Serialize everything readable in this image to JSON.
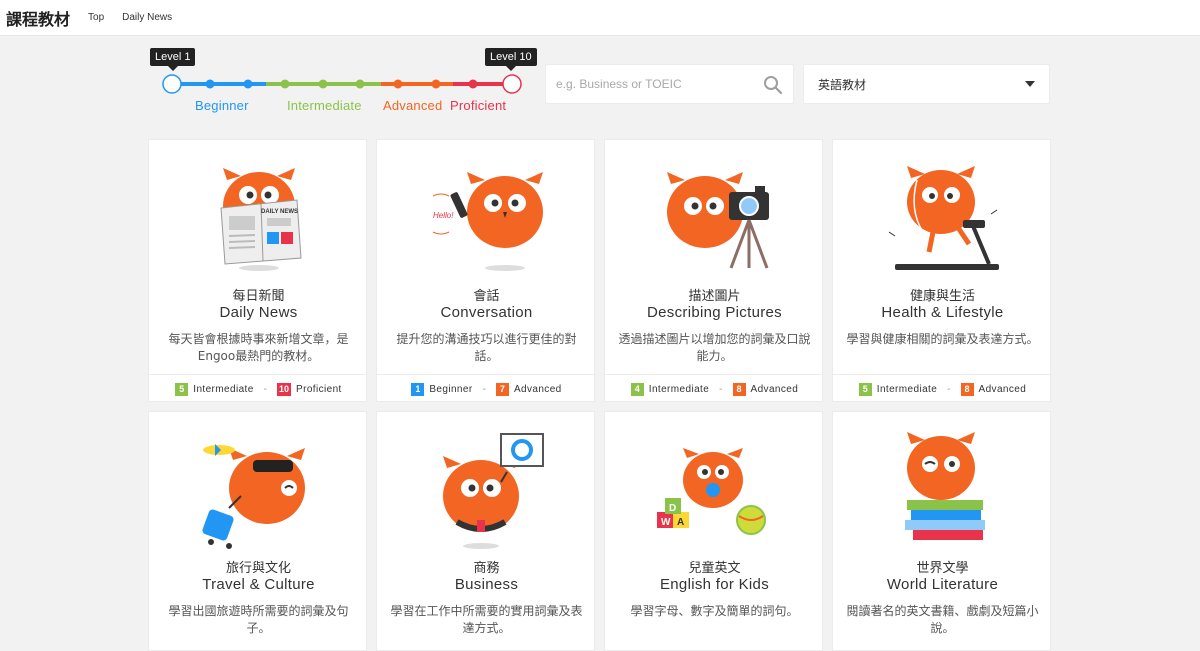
{
  "header": {
    "title": "課程教材",
    "nav": [
      "Top",
      "Daily News"
    ]
  },
  "slider": {
    "min_tip": "Level 1",
    "max_tip": "Level 10",
    "stages": [
      {
        "label": "Beginner",
        "color": "#2196f3"
      },
      {
        "label": "Intermediate",
        "color": "#8bc34a"
      },
      {
        "label": "Advanced",
        "color": "#f26522"
      },
      {
        "label": "Proficient",
        "color": "#e8334a"
      }
    ]
  },
  "search": {
    "placeholder": "e.g. Business or TOEIC",
    "icon": "search-icon"
  },
  "language_select": {
    "value": "英語教材"
  },
  "colors": {
    "beginner": "#2196f3",
    "intermediate": "#8bc34a",
    "advanced": "#f26522",
    "proficient": "#e8334a",
    "owl": "#f26522"
  },
  "courses": [
    {
      "zh": "每日新聞",
      "en": "Daily News",
      "desc": "每天皆會根據時事來新增文章，是Engoo最熱門的教材。",
      "from": {
        "num": "5",
        "label": "Intermediate"
      },
      "to": {
        "num": "10",
        "label": "Proficient"
      },
      "art": "owl-newspaper"
    },
    {
      "zh": "會話",
      "en": "Conversation",
      "desc": "提升您的溝通技巧以進行更佳的對話。",
      "from": {
        "num": "1",
        "label": "Beginner"
      },
      "to": {
        "num": "7",
        "label": "Advanced"
      },
      "art": "owl-phone",
      "art_text": "Hello!"
    },
    {
      "zh": "描述圖片",
      "en": "Describing Pictures",
      "desc": "透過描述圖片以增加您的詞彙及口說能力。",
      "from": {
        "num": "4",
        "label": "Intermediate"
      },
      "to": {
        "num": "8",
        "label": "Advanced"
      },
      "art": "owl-camera"
    },
    {
      "zh": "健康與生活",
      "en": "Health & Lifestyle",
      "desc": "學習與健康相關的詞彙及表達方式。",
      "from": {
        "num": "5",
        "label": "Intermediate"
      },
      "to": {
        "num": "8",
        "label": "Advanced"
      },
      "art": "owl-treadmill"
    },
    {
      "zh": "旅行與文化",
      "en": "Travel & Culture",
      "desc": "學習出國旅遊時所需要的詞彙及句子。",
      "art": "owl-travel"
    },
    {
      "zh": "商務",
      "en": "Business",
      "desc": "學習在工作中所需要的實用詞彙及表達方式。",
      "art": "owl-business"
    },
    {
      "zh": "兒童英文",
      "en": "English for Kids",
      "desc": "學習字母、數字及簡單的詞句。",
      "art": "owl-kids"
    },
    {
      "zh": "世界文學",
      "en": "World Literature",
      "desc": "閱讀著名的英文書籍、戲劇及短篇小說。",
      "art": "owl-books"
    }
  ]
}
